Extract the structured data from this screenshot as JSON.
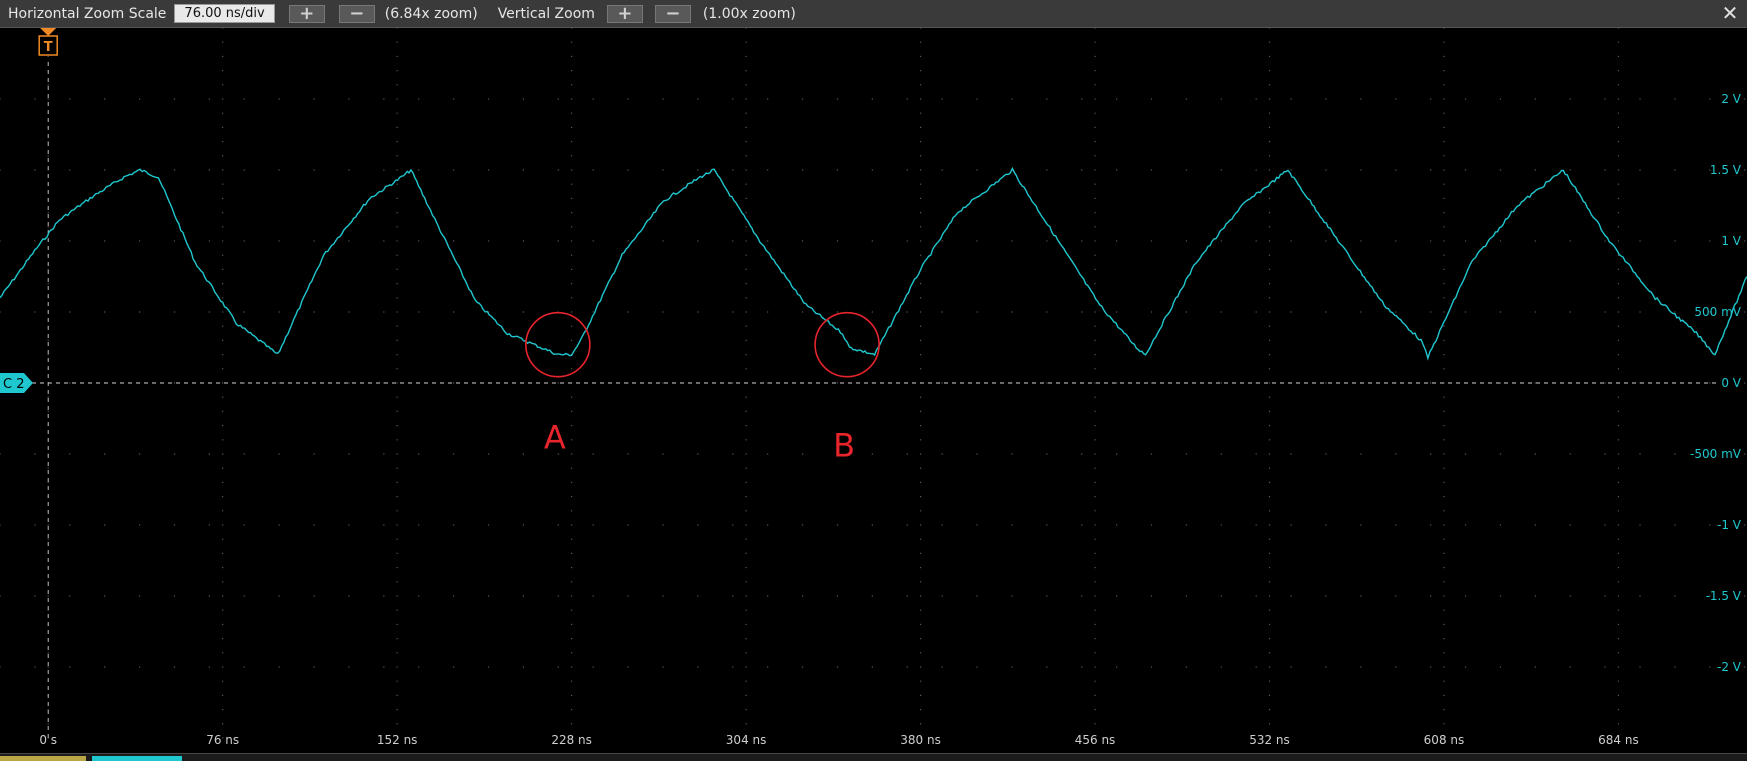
{
  "toolbar": {
    "h_label": "Horizontal Zoom Scale",
    "h_scale": "76.00 ns/div",
    "plus_glyph": "+",
    "minus_glyph": "−",
    "h_zoom": "(6.84x zoom)",
    "v_label": "Vertical Zoom",
    "v_zoom": "(1.00x zoom)",
    "close_glyph": "✕"
  },
  "trigger": {
    "label": "T",
    "color": "#f08a24"
  },
  "channel": {
    "label": "C 2",
    "color": "#1fc7cf"
  },
  "annotations": [
    {
      "label": "A",
      "color": "#e8242c"
    },
    {
      "label": "B",
      "color": "#e8242c"
    }
  ],
  "chart_data": {
    "type": "line",
    "x_unit": "ns",
    "x_tick_values": [
      0,
      76,
      152,
      228,
      304,
      380,
      456,
      532,
      608,
      684
    ],
    "x_tick_labels": [
      "0 s",
      "76 ns",
      "152 ns",
      "228 ns",
      "304 ns",
      "380 ns",
      "456 ns",
      "532 ns",
      "608 ns",
      "684 ns"
    ],
    "xlim": [
      -21,
      740
    ],
    "y_unit": "V",
    "y_tick_values": [
      2,
      1.5,
      1,
      0.5,
      0,
      -0.5,
      -1,
      -1.5,
      -2
    ],
    "y_tick_labels": [
      "2 V",
      "1.5 V",
      "1 V",
      "500 mV",
      "0 V",
      "-500 mV",
      "-1 V",
      "-1.5 V",
      "-2 V"
    ],
    "ylim": [
      -2.5,
      2.5
    ],
    "grid": true,
    "series": [
      {
        "color": "#1fc7cf",
        "x": [
          -21,
          -5,
          5,
          20,
          33,
          40,
          48,
          64,
          82,
          96,
          100,
          120,
          140,
          154,
          158,
          170,
          186,
          200,
          222,
          228,
          232,
          250,
          268,
          284,
          290,
          310,
          330,
          346,
          349,
          360,
          380,
          396,
          412,
          420,
          438,
          458,
          474,
          478,
          500,
          520,
          536,
          540,
          562,
          582,
          598,
          601,
          620,
          640,
          656,
          660,
          680,
          700,
          718,
          726,
          740
        ],
        "y": [
          0.6,
          0.95,
          1.15,
          1.32,
          1.45,
          1.5,
          1.45,
          0.85,
          0.42,
          0.25,
          0.2,
          0.9,
          1.3,
          1.45,
          1.5,
          1.1,
          0.58,
          0.35,
          0.2,
          0.2,
          0.3,
          0.9,
          1.28,
          1.45,
          1.5,
          1.0,
          0.55,
          0.35,
          0.25,
          0.2,
          0.8,
          1.2,
          1.4,
          1.5,
          1.05,
          0.55,
          0.25,
          0.2,
          0.85,
          1.25,
          1.45,
          1.5,
          1.0,
          0.55,
          0.3,
          0.18,
          0.85,
          1.25,
          1.45,
          1.5,
          1.0,
          0.6,
          0.35,
          0.2,
          0.75
        ]
      }
    ],
    "trigger_x": 0,
    "annotation_points": [
      {
        "x": 222,
        "y": 0.27
      },
      {
        "x": 348,
        "y": 0.27
      }
    ]
  }
}
